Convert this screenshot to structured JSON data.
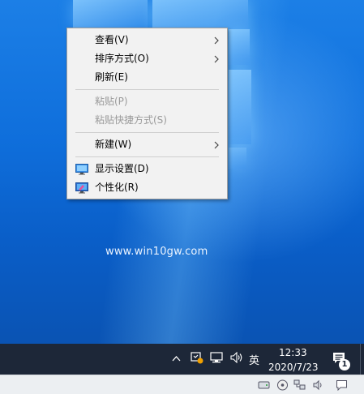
{
  "context_menu": {
    "items": [
      {
        "label": "查看(V)",
        "has_submenu": true,
        "disabled": false
      },
      {
        "label": "排序方式(O)",
        "has_submenu": true,
        "disabled": false
      },
      {
        "label": "刷新(E)",
        "has_submenu": false,
        "disabled": false
      },
      {
        "label": "粘贴(P)",
        "has_submenu": false,
        "disabled": true
      },
      {
        "label": "粘贴快捷方式(S)",
        "has_submenu": false,
        "disabled": true
      },
      {
        "label": "新建(W)",
        "has_submenu": true,
        "disabled": false
      },
      {
        "label": "显示设置(D)",
        "icon": "display-settings-icon",
        "disabled": false
      },
      {
        "label": "个性化(R)",
        "icon": "personalize-icon",
        "disabled": false
      }
    ]
  },
  "desktop": {
    "watermark": "www.win10gw.com"
  },
  "taskbar": {
    "ime_label": "英",
    "clock_time": "12:33",
    "clock_date": "2020/7/23",
    "notification_count": "1"
  },
  "colors": {
    "taskbar_bg": "#1d2738",
    "desktop_blue": "#0f6fdc",
    "menu_bg": "#f2f2f2"
  }
}
